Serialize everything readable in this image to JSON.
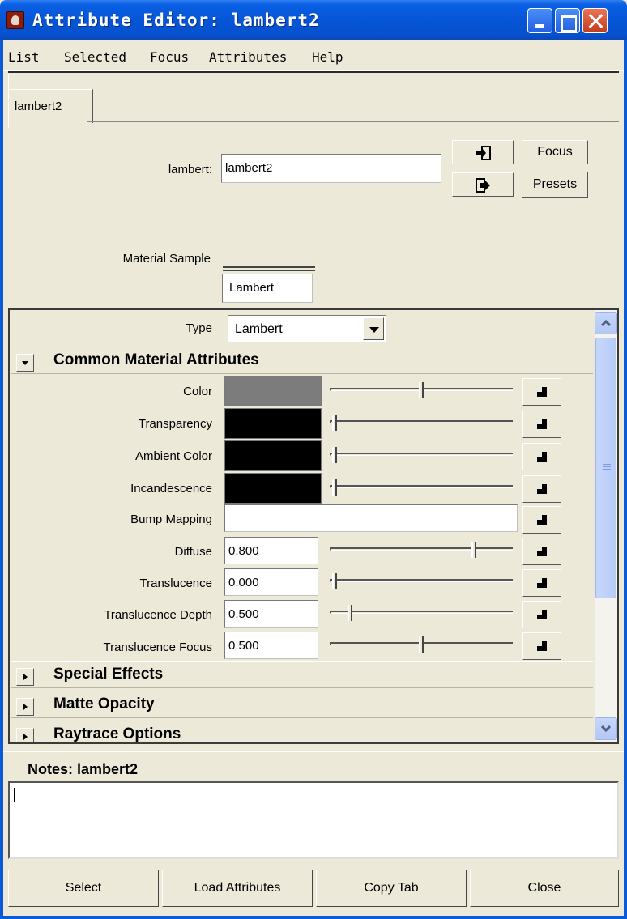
{
  "window": {
    "title": "Attribute Editor: lambert2"
  },
  "menu": [
    "List",
    "Selected",
    "Focus",
    "Attributes",
    "Help"
  ],
  "tabs": [
    {
      "label": "lambert2"
    }
  ],
  "header": {
    "node_label": "lambert:",
    "node_value": "lambert2",
    "focus_button": "Focus",
    "presets_button": "Presets",
    "material_sample_label": "Material Sample",
    "material_sample_value": "Lambert"
  },
  "type_row": {
    "label": "Type",
    "value": "Lambert"
  },
  "sections": {
    "common": {
      "title": "Common Material Attributes",
      "expanded": true
    },
    "special_effects": {
      "title": "Special Effects",
      "expanded": false
    },
    "matte_opacity": {
      "title": "Matte Opacity",
      "expanded": false
    },
    "raytrace": {
      "title": "Raytrace Options",
      "expanded": false
    }
  },
  "attributes": {
    "color": {
      "label": "Color",
      "swatch": "#7c7c7c",
      "slider": 0.5
    },
    "transparency": {
      "label": "Transparency",
      "swatch": "#000000",
      "slider": 0.0
    },
    "ambient_color": {
      "label": "Ambient Color",
      "swatch": "#000000",
      "slider": 0.0
    },
    "incandescence": {
      "label": "Incandescence",
      "swatch": "#000000",
      "slider": 0.0
    },
    "bump_mapping": {
      "label": "Bump Mapping",
      "value": ""
    },
    "diffuse": {
      "label": "Diffuse",
      "value": "0.800",
      "slider": 0.8
    },
    "translucence": {
      "label": "Translucence",
      "value": "0.000",
      "slider": 0.0
    },
    "translucence_depth": {
      "label": "Translucence Depth",
      "value": "0.500",
      "slider": 0.1
    },
    "translucence_focus": {
      "label": "Translucence Focus",
      "value": "0.500",
      "slider": 0.5
    }
  },
  "notes": {
    "title": "Notes:  lambert2",
    "text": ""
  },
  "buttons": {
    "select": "Select",
    "load_attributes": "Load Attributes",
    "copy_tab": "Copy Tab",
    "close": "Close"
  },
  "icons": {
    "title_icon": "maya-app-icon",
    "load_input_icon": "input-connection-icon",
    "load_output_icon": "output-connection-icon",
    "map_button_icon": "checker-map-icon"
  }
}
